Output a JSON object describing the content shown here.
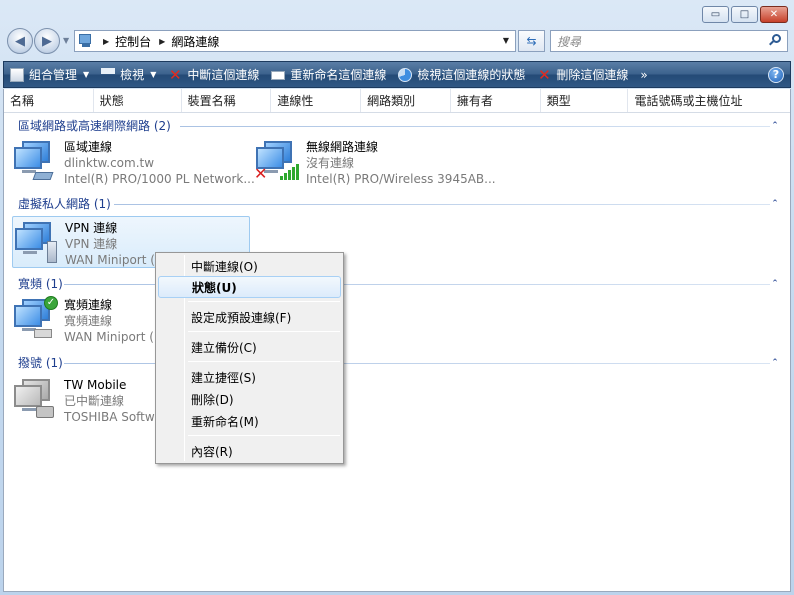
{
  "window": {
    "controls": [
      {
        "name": "minimize",
        "glyph": "▭"
      },
      {
        "name": "maximize",
        "glyph": "□"
      },
      {
        "name": "close",
        "glyph": "✕"
      }
    ]
  },
  "address": {
    "breadcrumbs": [
      "控制台",
      "網路連線"
    ],
    "search_placeholder": "搜尋"
  },
  "commandbar": {
    "organize": "組合管理",
    "view": "檢視",
    "disable": "中斷這個連線",
    "rename": "重新命名這個連線",
    "view_status": "檢視這個連線的狀態",
    "delete": "刪除這個連線",
    "more": "»",
    "help": "?"
  },
  "columns": [
    "名稱",
    "狀態",
    "裝置名稱",
    "連線性",
    "網路類別",
    "擁有者",
    "類型",
    "電話號碼或主機位址"
  ],
  "groups": [
    {
      "title": "區域網路或高速網際網路 (2)",
      "items": [
        {
          "name": "區域連線",
          "status": "dlinktw.com.tw",
          "device": "Intel(R) PRO/1000 PL Network..."
        },
        {
          "name": "無線網路連線",
          "status": "沒有連線",
          "device": "Intel(R) PRO/Wireless 3945AB..."
        }
      ]
    },
    {
      "title": "虛擬私人網路 (1)",
      "items": [
        {
          "name": "VPN 連線",
          "status": "VPN 連線",
          "device": "WAN Miniport ("
        }
      ]
    },
    {
      "title": "寬頻 (1)",
      "items": [
        {
          "name": "寬頻連線",
          "status": "寬頻連線",
          "device": "WAN Miniport ("
        }
      ]
    },
    {
      "title": "撥號 (1)",
      "items": [
        {
          "name": "TW Mobile",
          "status": "已中斷連線",
          "device": "TOSHIBA Softwa"
        }
      ]
    }
  ],
  "context_menu": {
    "items": [
      "中斷連線(O)",
      "狀態(U)",
      "設定成預設連線(F)",
      "建立備份(C)",
      "建立捷徑(S)",
      "刪除(D)",
      "重新命名(M)",
      "內容(R)"
    ],
    "default_item": "狀態(U)"
  },
  "colors": {
    "group_header": "#1e3e8e",
    "command_bar": "#3c628d",
    "selection": "#d9ecfb"
  }
}
